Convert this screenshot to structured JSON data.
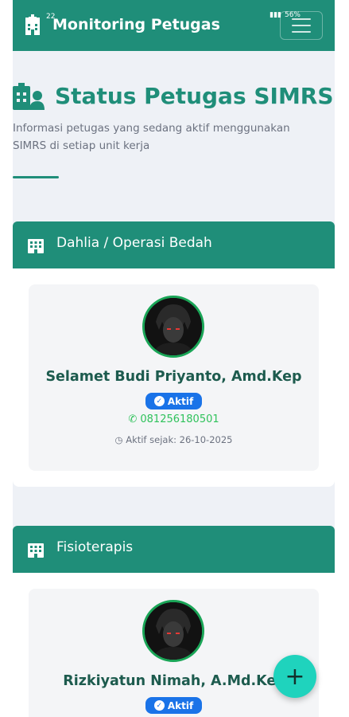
{
  "statusbar": {
    "time": "22",
    "battery": "56%"
  },
  "header": {
    "title": "Monitoring Petugas"
  },
  "page": {
    "title": "Status Petugas SIMRS",
    "subtitle_line1": "Informasi petugas yang sedang aktif menggunakan",
    "subtitle_line2": "SIMRS di setiap unit kerja"
  },
  "units": [
    {
      "name": "Dahlia / Operasi Bedah",
      "staff": {
        "name": "Selamet Budi Priyanto, Amd.Kep",
        "status": "Aktif",
        "phone": "081256180501",
        "since": "Aktif sejak: 26-10-2025"
      }
    },
    {
      "name": "Fisioterapis",
      "staff": {
        "name": "Rizkiyatun Nimah, A.Md.Kes",
        "status": "Aktif"
      }
    }
  ],
  "fab": {
    "label": "+"
  },
  "colors": {
    "primary": "#1f8e79",
    "badge": "#1a73e8",
    "phone": "#2fc25b"
  }
}
